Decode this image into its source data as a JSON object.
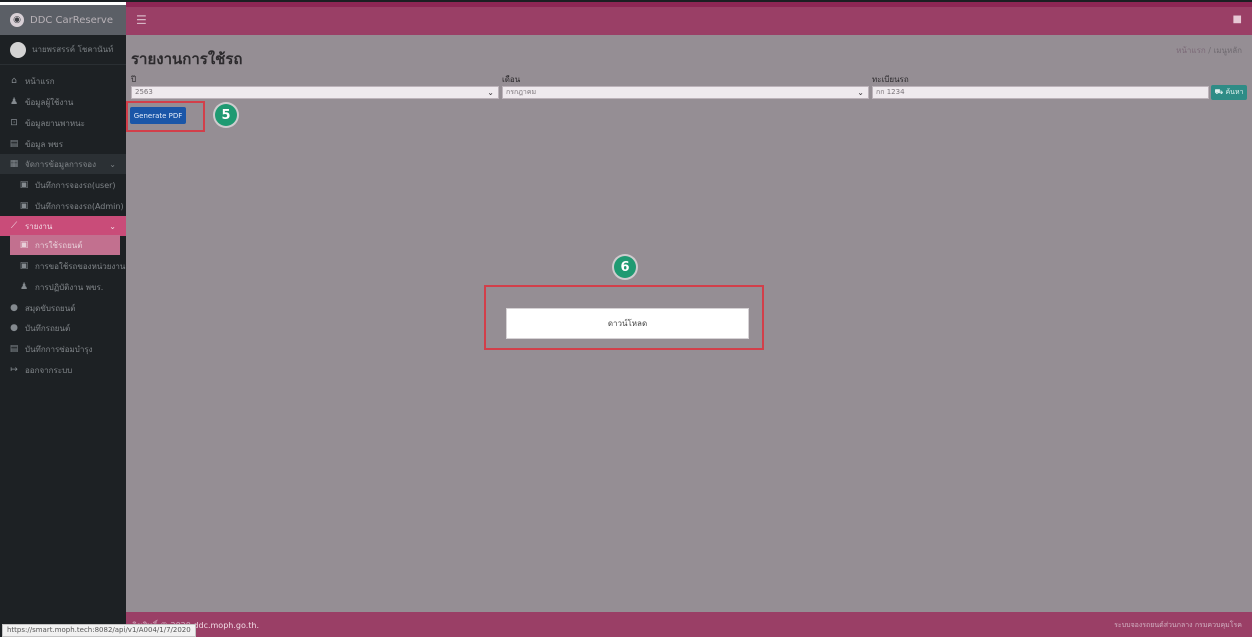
{
  "brand": {
    "title": "DDC CarReserve"
  },
  "topbar": {
    "menu_icon": "☰",
    "right_icon": "■"
  },
  "user": {
    "name": "นายพรสรรค์ โชคานันท์"
  },
  "sidebar": {
    "items": [
      {
        "icon": "⌂",
        "label": "หน้าแรก"
      },
      {
        "icon": "♟",
        "label": "ข้อมูลผู้ใช้งาน"
      },
      {
        "icon": "⊡",
        "label": "ข้อมูลยานพาหนะ"
      },
      {
        "icon": "▤",
        "label": "ข้อมูล พขร"
      },
      {
        "icon": "▦",
        "label": "จัดการข้อมูลการจอง",
        "chevron": "⌄"
      },
      {
        "icon": "▣",
        "label": "บันทึกการจองรถ(user)"
      },
      {
        "icon": "▣",
        "label": "บันทึกการจองรถ(Admin)"
      },
      {
        "icon": "⟋",
        "label": "รายงาน",
        "chevron": "⌄"
      },
      {
        "icon": "▣",
        "label": "การใช้รถยนต์"
      },
      {
        "icon": "▣",
        "label": "การขอใช้รถของหน่วยงาน"
      },
      {
        "icon": "♟",
        "label": "การปฏิบัติงาน พขร."
      },
      {
        "icon": "●",
        "label": "สมุดขับรถยนต์"
      },
      {
        "icon": "●",
        "label": "บันทึกรถยนต์"
      },
      {
        "icon": "▤",
        "label": "บันทึกการซ่อมบำรุง"
      },
      {
        "icon": "↦",
        "label": "ออกจากระบบ"
      }
    ]
  },
  "page": {
    "title": "รายงานการใช้รถ",
    "breadcrumb": {
      "home": "หน้าแรก",
      "sep": "/",
      "current": "เมนูหลัก"
    }
  },
  "filters": {
    "year": {
      "label": "ปี",
      "value": "2563",
      "caret": "⌄"
    },
    "month": {
      "label": "เดือน",
      "value": "กรกฎาคม",
      "caret": "⌄"
    },
    "plate": {
      "label": "ทะเบียนรถ",
      "placeholder": "กก 1234"
    },
    "search_label": "⛟ ค้นหา"
  },
  "actions": {
    "generate_pdf": "Generate PDF"
  },
  "annotations": {
    "step5": "5",
    "step6": "6"
  },
  "download": {
    "label": "ดาวน์โหลด"
  },
  "footer": {
    "copyright": "ลิขสิทธิ์ © 2020",
    "site": "ddc.moph.go.th.",
    "right": "ระบบจองรถยนต์ส่วนกลาง กรมควบคุมโรค"
  },
  "status_url": "https://smart.moph.tech:8082/api/v1/A004/1/7/2020",
  "colors": {
    "accent": "#9a3f66",
    "sidebar": "#1d2124",
    "primary_button": "#1a56a8",
    "search_button": "#2e8c86",
    "badge": "#1f9a72",
    "highlight": "#d23f4a"
  }
}
